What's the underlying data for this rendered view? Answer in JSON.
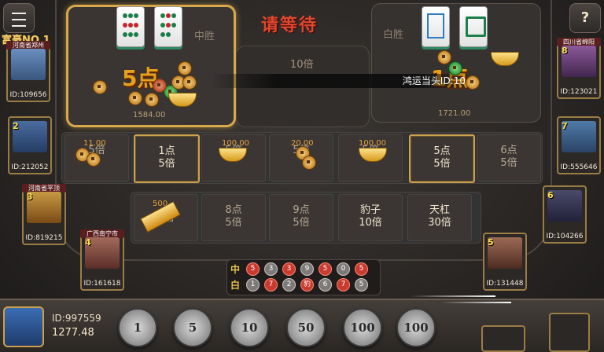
{
  "header": {
    "status_text": "请等待"
  },
  "zhong_panel": {
    "label": "中胜",
    "points": "5点",
    "amount": "1584.00"
  },
  "bai_panel": {
    "label": "白胜",
    "points": "1点",
    "amount": "1721.00"
  },
  "center_panel": {
    "multiplier": "10倍"
  },
  "announcement": "鸿运当头ID:10",
  "rich_label": "富豪NO.1",
  "bet_row1": [
    {
      "label": "",
      "odds": "5倍",
      "chip": "11.00"
    },
    {
      "label": "1点",
      "odds": "5倍",
      "highlight": true
    },
    {
      "label": "",
      "odds": "5倍",
      "chip": "100.00"
    },
    {
      "label": "",
      "odds": "5倍",
      "chip": "20.00"
    },
    {
      "label": "",
      "odds": "5倍",
      "chip": "100.00"
    },
    {
      "label": "5点",
      "odds": "5倍",
      "highlight": true
    },
    {
      "label": "6点",
      "odds": "5倍"
    }
  ],
  "bet_row2": [
    {
      "label": "",
      "odds": "5倍",
      "chip": "500"
    },
    {
      "label": "8点",
      "odds": "5倍"
    },
    {
      "label": "9点",
      "odds": "5倍"
    },
    {
      "label": "豹子",
      "odds": "10倍"
    },
    {
      "label": "天杠",
      "odds": "30倍"
    }
  ],
  "history": {
    "row_labels": [
      "中",
      "白"
    ],
    "zhong": [
      "5",
      "3",
      "3",
      "9",
      "5",
      "0",
      "5"
    ],
    "bai": [
      "1",
      "7",
      "2",
      "豹",
      "6",
      "7",
      "5"
    ]
  },
  "players_left": [
    {
      "location": "河南省郑州",
      "id": "ID:109656",
      "rank": ""
    },
    {
      "location": "",
      "id": "ID:212052",
      "rank": "2"
    },
    {
      "location": "河南省平顶",
      "id": "ID:819215",
      "rank": "3"
    },
    {
      "location": "广西南宁市",
      "id": "ID:161618",
      "rank": "4"
    }
  ],
  "players_right": [
    {
      "location": "四川省绵阳",
      "id": "ID:123021",
      "rank": "8"
    },
    {
      "location": "",
      "id": "ID:555646",
      "rank": "7"
    },
    {
      "location": "",
      "id": "ID:104266",
      "rank": "6"
    },
    {
      "location": "",
      "id": "ID:131448",
      "rank": "5"
    }
  ],
  "self": {
    "id": "ID:997559",
    "balance": "1277.48"
  },
  "chips": [
    "1",
    "5",
    "10",
    "50",
    "100",
    "100"
  ],
  "help_label": "?",
  "colors": {
    "accent_gold": "#d7a94a",
    "wait_red": "#e0482f",
    "tile_green": "#2e8a63"
  }
}
